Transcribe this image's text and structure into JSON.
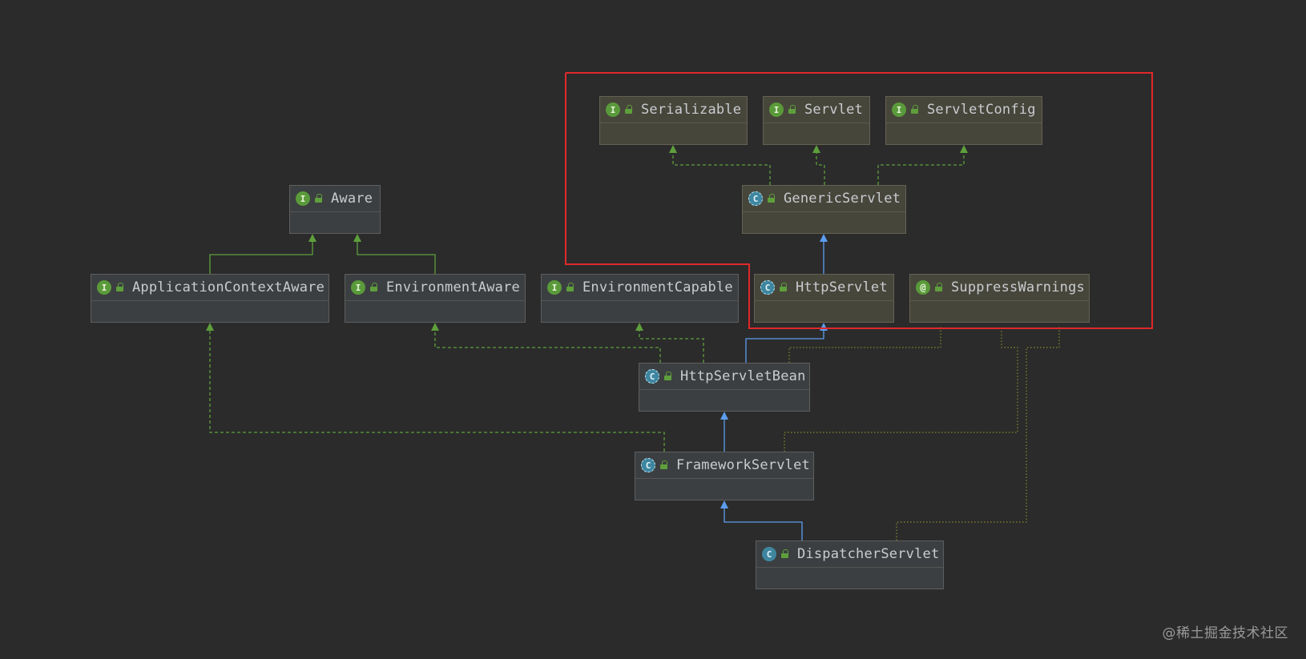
{
  "diagram": {
    "nodes": [
      {
        "id": "aware",
        "name": "Aware",
        "kind": "interface",
        "highlighted": false
      },
      {
        "id": "applicationcontextaware",
        "name": "ApplicationContextAware",
        "kind": "interface",
        "highlighted": false
      },
      {
        "id": "environmentaware",
        "name": "EnvironmentAware",
        "kind": "interface",
        "highlighted": false
      },
      {
        "id": "environmentcapable",
        "name": "EnvironmentCapable",
        "kind": "interface",
        "highlighted": false
      },
      {
        "id": "serializable",
        "name": "Serializable",
        "kind": "interface",
        "highlighted": true
      },
      {
        "id": "servlet",
        "name": "Servlet",
        "kind": "interface",
        "highlighted": true
      },
      {
        "id": "servletconfig",
        "name": "ServletConfig",
        "kind": "interface",
        "highlighted": true
      },
      {
        "id": "genericservlet",
        "name": "GenericServlet",
        "kind": "abstract-class",
        "highlighted": true
      },
      {
        "id": "httpservlet",
        "name": "HttpServlet",
        "kind": "abstract-class",
        "highlighted": true
      },
      {
        "id": "suppresswarnings",
        "name": "SuppressWarnings",
        "kind": "annotation",
        "highlighted": true
      },
      {
        "id": "httpservletbean",
        "name": "HttpServletBean",
        "kind": "abstract-class",
        "highlighted": false
      },
      {
        "id": "frameworkservlet",
        "name": "FrameworkServlet",
        "kind": "abstract-class",
        "highlighted": false
      },
      {
        "id": "dispatcherservlet",
        "name": "DispatcherServlet",
        "kind": "class",
        "highlighted": false
      }
    ],
    "edges": [
      {
        "from": "applicationcontextaware",
        "to": "aware",
        "type": "interface-extends"
      },
      {
        "from": "environmentaware",
        "to": "aware",
        "type": "interface-extends"
      },
      {
        "from": "genericservlet",
        "to": "serializable",
        "type": "implements"
      },
      {
        "from": "genericservlet",
        "to": "servlet",
        "type": "implements"
      },
      {
        "from": "genericservlet",
        "to": "servletconfig",
        "type": "implements"
      },
      {
        "from": "httpservlet",
        "to": "genericservlet",
        "type": "extends"
      },
      {
        "from": "httpservletbean",
        "to": "httpservlet",
        "type": "extends"
      },
      {
        "from": "httpservletbean",
        "to": "environmentaware",
        "type": "implements"
      },
      {
        "from": "httpservletbean",
        "to": "environmentcapable",
        "type": "implements"
      },
      {
        "from": "frameworkservlet",
        "to": "httpservletbean",
        "type": "extends"
      },
      {
        "from": "frameworkservlet",
        "to": "applicationcontextaware",
        "type": "implements"
      },
      {
        "from": "dispatcherservlet",
        "to": "frameworkservlet",
        "type": "extends"
      },
      {
        "from": "httpservletbean",
        "to": "suppresswarnings",
        "type": "annotated-with"
      },
      {
        "from": "frameworkservlet",
        "to": "suppresswarnings",
        "type": "annotated-with"
      },
      {
        "from": "dispatcherservlet",
        "to": "suppresswarnings",
        "type": "annotated-with"
      }
    ],
    "kind_glyphs": {
      "interface": "I",
      "class": "C",
      "abstract-class": "C",
      "annotation": "@"
    },
    "colors": {
      "background": "#2b2b2b",
      "interface_badge": "#5a9a3a",
      "class_badge": "#3e86a0",
      "extends_edge": "#5c9ded",
      "implements_edge": "#5e9f3c",
      "annotation_edge": "#8a8a2e",
      "highlight_box": "#e0282a"
    }
  },
  "watermark": "@稀土掘金技术社区"
}
